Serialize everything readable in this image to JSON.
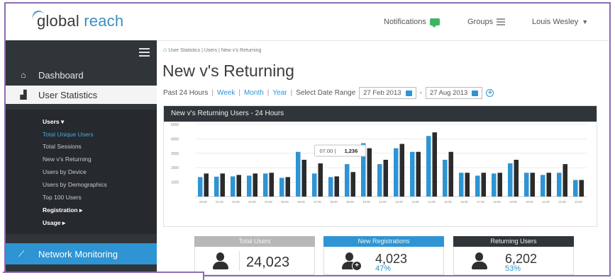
{
  "app": {
    "logo_prefix": "global",
    "logo_suffix": "reach"
  },
  "topnav": {
    "notifications": "Notifications",
    "groups": "Groups",
    "user": "Louis Wesley"
  },
  "sidebar": {
    "items": [
      {
        "label": "Dashboard",
        "icon": "home-icon"
      },
      {
        "label": "User Statistics",
        "icon": "bar-chart-icon"
      }
    ],
    "sub_items": [
      {
        "label": "Users ▾"
      },
      {
        "label": "Total Unique Users"
      },
      {
        "label": "Total Sessions"
      },
      {
        "label": "New v's Returning"
      },
      {
        "label": "Users by Device"
      },
      {
        "label": "Users by Demographics"
      },
      {
        "label": "Top 100 Users"
      },
      {
        "label": "Registration ▸"
      },
      {
        "label": "Usage ▸"
      }
    ],
    "network": {
      "label": "Network Monitoring",
      "icon": "line-chart-icon"
    }
  },
  "breadcrumb": "User Statistics  |  Users  |  New v's Returning",
  "page": {
    "title": "New v's Returning"
  },
  "filters": {
    "past": "Past 24 Hours",
    "week": "Week",
    "month": "Month",
    "year": "Year",
    "range_label": "Select Date Range",
    "from": "27 Feb 2013",
    "to": "27 Aug 2013",
    "dash": "-"
  },
  "panel": {
    "title": "New v's Returning Users - 24 Hours"
  },
  "tooltip": {
    "time": "07.00",
    "value": "1,236"
  },
  "colors": {
    "new": "#2e94d3",
    "returning": "#2b2b2b",
    "header_dark": "#30353a",
    "accent": "#2e94d3",
    "total_head": "#b8b8b8"
  },
  "chart_data": {
    "type": "bar",
    "title": "New v's Returning Users - 24 Hours",
    "ylim": [
      0,
      5000
    ],
    "yticks": [
      "5000",
      "4000",
      "3000",
      "2000",
      "1000"
    ],
    "ytick_values": [
      5000,
      4000,
      3000,
      2000,
      1000
    ],
    "categories": [
      "00.00",
      "01.00",
      "02.00",
      "03.00",
      "04.00",
      "05.00",
      "06.00",
      "07.00",
      "08.00",
      "09.00",
      "10.00",
      "11.00",
      "12.00",
      "13.00",
      "14.00",
      "15.00",
      "16.00",
      "17.00",
      "18.00",
      "19.00",
      "20.00",
      "21.00",
      "22.00",
      "23.00"
    ],
    "series": [
      {
        "values": [
          1350,
          1380,
          1400,
          1450,
          1600,
          1300,
          3100,
          1600,
          1350,
          2250,
          3700,
          2250,
          3350,
          3100,
          4200,
          2550,
          1650,
          1450,
          1600,
          2300,
          1650,
          1500,
          1650,
          1150
        ]
      },
      {
        "values": [
          1600,
          1600,
          1500,
          1600,
          1650,
          1350,
          2550,
          2300,
          1400,
          1700,
          3350,
          2550,
          3650,
          3100,
          4450,
          3100,
          1650,
          1650,
          1650,
          2550,
          1650,
          1650,
          2250,
          1150
        ]
      }
    ],
    "grid": true
  },
  "stats": [
    {
      "label": "Total Users",
      "value": "24,023",
      "pct": ""
    },
    {
      "label": "New Registrations",
      "value": "4,023",
      "pct": "47%"
    },
    {
      "label": "Returning Users",
      "value": "6,202",
      "pct": "53%"
    }
  ]
}
